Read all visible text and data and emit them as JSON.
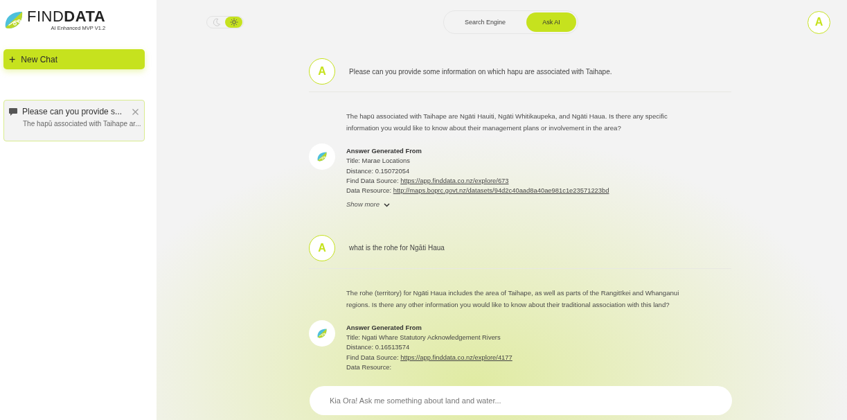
{
  "brand": {
    "name_light": "FIND",
    "name_bold": "DATA",
    "tagline": "AI Enhanced MVP V1.2"
  },
  "new_chat": {
    "icon": "+",
    "label": "New Chat"
  },
  "history": [
    {
      "title": "Please can you provide s...",
      "preview": "The hapū associated with Taihape ar...",
      "selected": true
    }
  ],
  "theme_toggle": {
    "dark": false
  },
  "mode_tabs": [
    {
      "label": "Search Engine",
      "selected": false
    },
    {
      "label": "Ask AI",
      "selected": true
    }
  ],
  "user_avatar": "A",
  "messages": [
    {
      "kind": "user",
      "avatar": "A",
      "text": "Please can you provide some information on which hapu are associated with Taihape."
    },
    {
      "kind": "answer",
      "text": "The hapū associated with Taihape are Ngāti Hauiti, Ngāti Whitikaupeka, and Ngāti Haua. Is there any specific information you would like to know about their management plans or involvement in the area?",
      "source_heading": "Answer Generated From",
      "source_lines": [
        {
          "label": "Title: Marae Locations"
        },
        {
          "label": "Distance: 0.15072054"
        },
        {
          "label": "Find Data Source:",
          "link": "https://app.finddata.co.nz/explore/673"
        },
        {
          "label": "Data Resource:",
          "link": "http://maps.boprc.govt.nz/datasets/94d2c40aad8a40ae981c1e23571223bd"
        }
      ],
      "show_more": "Show more"
    },
    {
      "kind": "user",
      "avatar": "A",
      "text": "what is the rohe for Ngāti Haua"
    },
    {
      "kind": "answer",
      "text": "The rohe (territory) for Ngāti Haua includes the area of Taihape, as well as parts of the Rangitīkei and Whanganui regions. Is there any other information you would like to know about their traditional association with this land?",
      "source_heading": "Answer Generated From",
      "source_lines": [
        {
          "label": "Title: Ngati Whare Statutory Acknowledgement Rivers"
        },
        {
          "label": "Distance: 0.16513574"
        },
        {
          "label": "Find Data Source:",
          "link": "https://app.finddata.co.nz/explore/4177"
        },
        {
          "label": "Data Resource:"
        }
      ]
    }
  ],
  "input": {
    "placeholder": "Kia Ora! Ask me something about land and water..."
  }
}
